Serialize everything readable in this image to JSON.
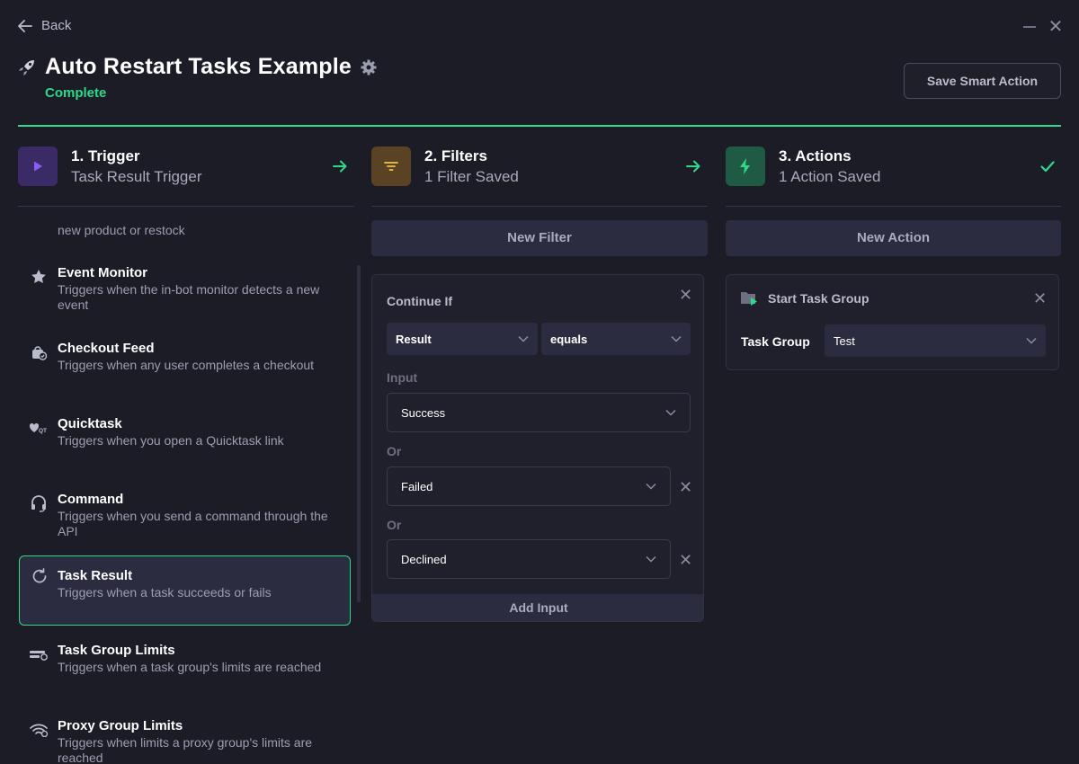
{
  "header": {
    "back_label": "Back",
    "title": "Auto Restart Tasks Example",
    "status": "Complete",
    "save_button": "Save Smart Action"
  },
  "steps": [
    {
      "title": "1. Trigger",
      "subtitle": "Task Result Trigger",
      "color": "#8b5cf6",
      "bg": "#3a2a66",
      "icon": "play-icon"
    },
    {
      "title": "2. Filters",
      "subtitle": "1 Filter Saved",
      "color": "#f4c14a",
      "bg": "#5a4324",
      "icon": "filter-icon"
    },
    {
      "title": "3. Actions",
      "subtitle": "1 Action Saved",
      "color": "#2fd98a",
      "bg": "#1e5a44",
      "icon": "bolt-icon"
    }
  ],
  "triggers": {
    "partial_desc": "new product or restock",
    "items": [
      {
        "title": "Event Monitor",
        "desc": "Triggers when the in-bot monitor detects a new event",
        "icon": "star-icon"
      },
      {
        "title": "Checkout Feed",
        "desc": "Triggers when any user completes a checkout",
        "icon": "checkout-icon"
      },
      {
        "title": "Quicktask",
        "desc": "Triggers when you open a Quicktask link",
        "icon": "quicktask-icon"
      },
      {
        "title": "Command",
        "desc": "Triggers when you send a command through the API",
        "icon": "headset-icon"
      },
      {
        "title": "Task Result",
        "desc": "Triggers when a task succeeds or fails",
        "icon": "refresh-icon",
        "selected": true
      },
      {
        "title": "Task Group Limits",
        "desc": "Triggers when a task group's limits are reached",
        "icon": "limit-icon"
      },
      {
        "title": "Proxy Group Limits",
        "desc": "Triggers when limits a proxy group's limits are reached",
        "icon": "wifi-icon"
      }
    ]
  },
  "filters": {
    "new_button": "New Filter",
    "card_title": "Continue If",
    "field_select": "Result",
    "operator_select": "equals",
    "input_label": "Input",
    "input_value": "Success",
    "or_label_1": "Or",
    "or_value_1": "Failed",
    "or_label_2": "Or",
    "or_value_2": "Declined",
    "add_input": "Add Input"
  },
  "actions": {
    "new_button": "New Action",
    "card_title": "Start Task Group",
    "group_label": "Task Group",
    "group_value": "Test"
  }
}
